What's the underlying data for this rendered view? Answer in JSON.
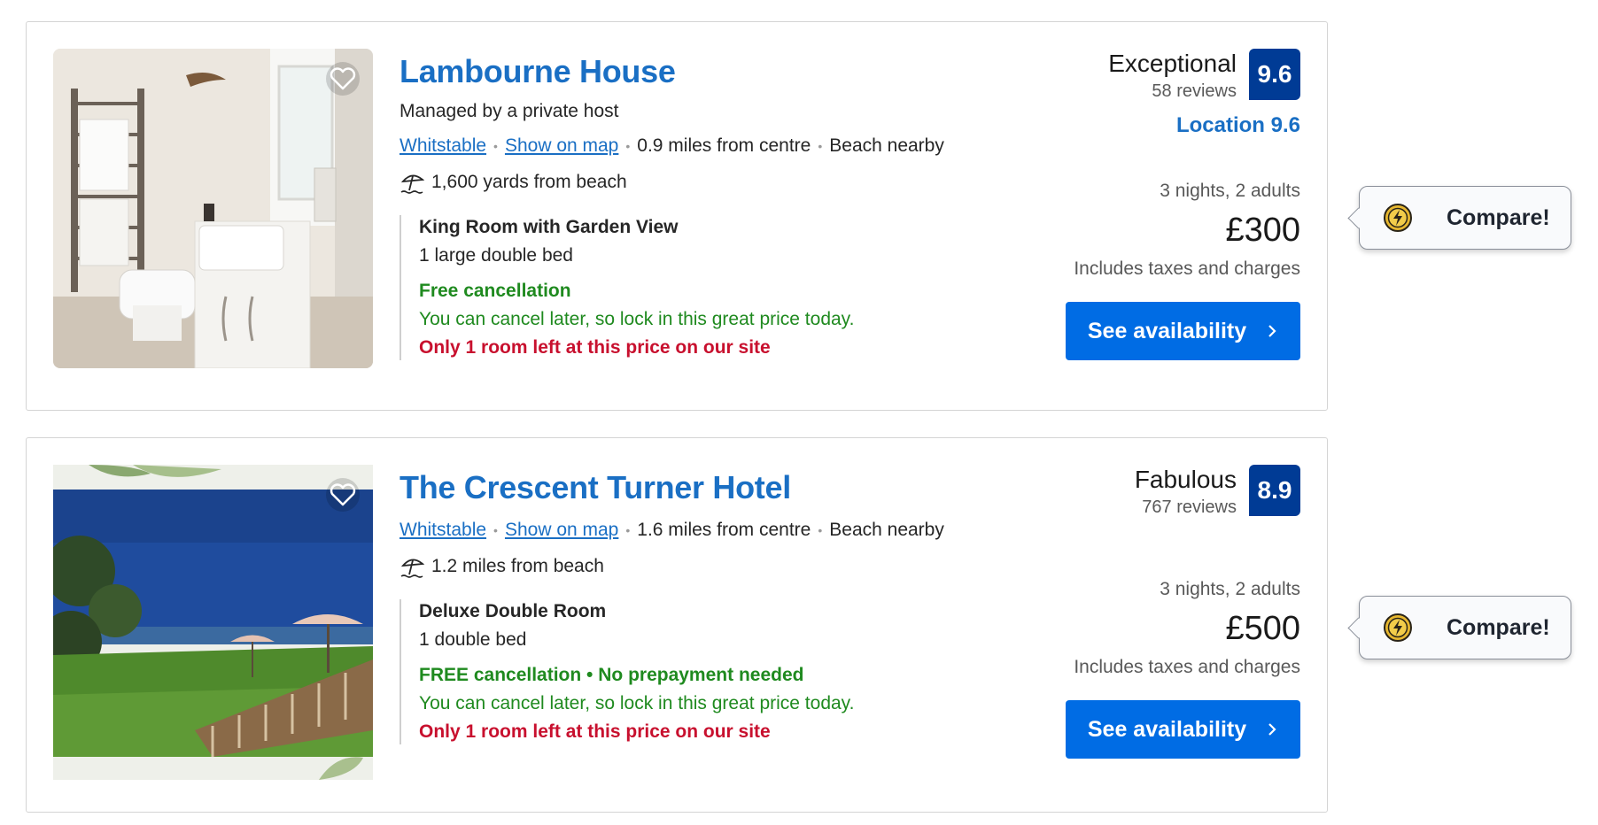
{
  "listings": [
    {
      "name": "Lambourne House",
      "managed_by": "Managed by a private host",
      "town": "Whitstable",
      "map_link": "Show on map",
      "distance_centre": "0.9 miles from centre",
      "beach_tag": "Beach nearby",
      "beach_distance": "1,600 yards from beach",
      "room_title": "King Room with Garden View",
      "bed": "1 large double bed",
      "cancellation": "Free cancellation",
      "cancel_note": "You can cancel later, so lock in this great price today.",
      "scarcity": "Only 1 room left at this price on our site",
      "score_word": "Exceptional",
      "reviews": "58 reviews",
      "score": "9.6",
      "location_score": "Location 9.6",
      "stay": "3 nights, 2 adults",
      "price": "£300",
      "taxes": "Includes taxes and charges",
      "cta": "See availability",
      "compare_label": "Compare!"
    },
    {
      "name": "The Crescent Turner Hotel",
      "town": "Whitstable",
      "map_link": "Show on map",
      "distance_centre": "1.6 miles from centre",
      "beach_tag": "Beach nearby",
      "beach_distance": "1.2 miles from beach",
      "room_title": "Deluxe Double Room",
      "bed": "1 double bed",
      "cancellation": "FREE cancellation • No prepayment needed",
      "cancel_note": "You can cancel later, so lock in this great price today.",
      "scarcity": "Only 1 room left at this price on our site",
      "score_word": "Fabulous",
      "reviews": "767 reviews",
      "score": "8.9",
      "stay": "3 nights, 2 adults",
      "price": "£500",
      "taxes": "Includes taxes and charges",
      "cta": "See availability",
      "compare_label": "Compare!"
    }
  ],
  "icons": {
    "favorite": "heart-icon",
    "beach": "beach-umbrella-icon",
    "cta_chevron": "chevron-right-icon",
    "compare": "lightning-coin-icon"
  },
  "colors": {
    "link": "#1a6fc4",
    "score_badge": "#003b95",
    "cta": "#006ce4",
    "positive": "#1f8a1f",
    "urgent": "#c8102e"
  }
}
